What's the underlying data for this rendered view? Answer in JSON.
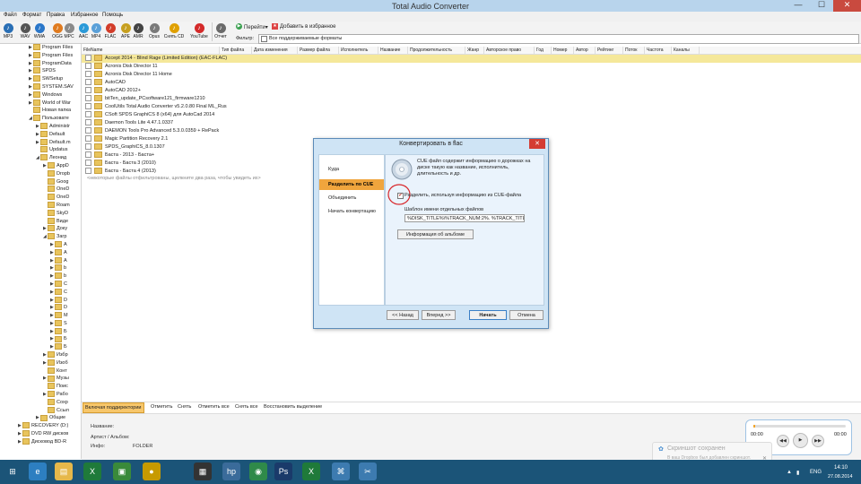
{
  "app_title": "Total Audio Converter",
  "window_buttons": {
    "minimize": "—",
    "maximize": "☐",
    "close": "✕"
  },
  "menu": [
    "Файл",
    "Формат",
    "Правка",
    "Избранное",
    "Помощь"
  ],
  "toolbar": {
    "formats": [
      {
        "label": "MP3",
        "color": "#2a6fb5"
      },
      {
        "label": "WAV",
        "color": "#555555"
      },
      {
        "label": "WMA",
        "color": "#2b77c9"
      },
      {
        "label": "OGG",
        "color": "#e07b1f"
      },
      {
        "label": "MPC",
        "color": "#8a8a8a"
      },
      {
        "label": "AAC",
        "color": "#2b9ad8"
      },
      {
        "label": "MP4",
        "color": "#5aa0d8"
      },
      {
        "label": "FLAC",
        "color": "#d23d2a"
      },
      {
        "label": "APE",
        "color": "#c7a020"
      },
      {
        "label": "AMR",
        "color": "#444444"
      },
      {
        "label": "Opus",
        "color": "#7a7a7a"
      },
      {
        "label": "Снять CD",
        "color": "#e0a000"
      },
      {
        "label": "YouTube",
        "color": "#d42a2a"
      },
      {
        "label": "Отчет",
        "color": "#6a6a6a"
      }
    ],
    "goto_label": "Перейти▾",
    "fav_label": "Добавить в избранное",
    "filter_label": "Фильтр:",
    "filter_value": "Все поддерживаемые форматы"
  },
  "tree": [
    {
      "label": "Program Files",
      "indent": 1,
      "exp": "▶"
    },
    {
      "label": "Program Files",
      "indent": 1,
      "exp": "▶"
    },
    {
      "label": "ProgramData",
      "indent": 1,
      "exp": "▶"
    },
    {
      "label": "SPDS",
      "indent": 1,
      "exp": "▶"
    },
    {
      "label": "SWSetup",
      "indent": 1,
      "exp": "▶"
    },
    {
      "label": "SYSTEM.SAV",
      "indent": 1,
      "exp": "▶"
    },
    {
      "label": "Windows",
      "indent": 1,
      "exp": "▶"
    },
    {
      "label": "World of War",
      "indent": 1,
      "exp": "▶"
    },
    {
      "label": "Новая папка",
      "indent": 1,
      "exp": ""
    },
    {
      "label": "Пользовате",
      "indent": 1,
      "exp": "◢"
    },
    {
      "label": "Administr",
      "indent": 2,
      "exp": "▶"
    },
    {
      "label": "Default",
      "indent": 2,
      "exp": "▶"
    },
    {
      "label": "Default.m",
      "indent": 2,
      "exp": "▶"
    },
    {
      "label": "Updatus",
      "indent": 2,
      "exp": ""
    },
    {
      "label": "Леонид",
      "indent": 2,
      "exp": "◢"
    },
    {
      "label": "AppD",
      "indent": 3,
      "exp": "▶"
    },
    {
      "label": "Dropb",
      "indent": 3,
      "exp": ""
    },
    {
      "label": "Goog",
      "indent": 3,
      "exp": ""
    },
    {
      "label": "OneD",
      "indent": 3,
      "exp": ""
    },
    {
      "label": "OneD",
      "indent": 3,
      "exp": ""
    },
    {
      "label": "Roam",
      "indent": 3,
      "exp": ""
    },
    {
      "label": "SkyD",
      "indent": 3,
      "exp": ""
    },
    {
      "label": "Виде",
      "indent": 3,
      "exp": ""
    },
    {
      "label": "Доку",
      "indent": 3,
      "exp": "▶"
    },
    {
      "label": "Загр",
      "indent": 3,
      "exp": "◢"
    },
    {
      "label": "A",
      "indent": 4,
      "exp": "▶"
    },
    {
      "label": "A",
      "indent": 4,
      "exp": "▶"
    },
    {
      "label": "A",
      "indent": 4,
      "exp": "▶"
    },
    {
      "label": "b",
      "indent": 4,
      "exp": "▶"
    },
    {
      "label": "b",
      "indent": 4,
      "exp": "▶"
    },
    {
      "label": "C",
      "indent": 4,
      "exp": "▶"
    },
    {
      "label": "C",
      "indent": 4,
      "exp": "▶"
    },
    {
      "label": "D",
      "indent": 4,
      "exp": "▶"
    },
    {
      "label": "D",
      "indent": 4,
      "exp": "▶"
    },
    {
      "label": "M",
      "indent": 4,
      "exp": "▶"
    },
    {
      "label": "S",
      "indent": 4,
      "exp": "▶"
    },
    {
      "label": "Б",
      "indent": 4,
      "exp": "▶"
    },
    {
      "label": "Б",
      "indent": 4,
      "exp": "▶"
    },
    {
      "label": "Б",
      "indent": 4,
      "exp": "▶"
    },
    {
      "label": "Избр",
      "indent": 3,
      "exp": "▶"
    },
    {
      "label": "Изоб",
      "indent": 3,
      "exp": "▶"
    },
    {
      "label": "Конт",
      "indent": 3,
      "exp": ""
    },
    {
      "label": "Музы",
      "indent": 3,
      "exp": "▶"
    },
    {
      "label": "Поис",
      "indent": 3,
      "exp": ""
    },
    {
      "label": "Рабо",
      "indent": 3,
      "exp": "▶"
    },
    {
      "label": "Сохр",
      "indent": 3,
      "exp": ""
    },
    {
      "label": "Ссыл",
      "indent": 3,
      "exp": ""
    },
    {
      "label": "Общие",
      "indent": 2,
      "exp": "▶"
    },
    {
      "label": "RECOVERY (D:)",
      "indent": 0,
      "exp": "▶"
    },
    {
      "label": "DVD RW дисков",
      "indent": 0,
      "exp": "▶"
    },
    {
      "label": "Дисковод BD-R",
      "indent": 0,
      "exp": "▶"
    }
  ],
  "columns": [
    "FileName",
    "Тип файла",
    "Дата изменения",
    "Размер файла",
    "Исполнитель",
    "Название",
    "Продолжительность",
    "Жанр",
    "Авторское право",
    "Год",
    "Номер",
    "Автор",
    "Рейтинг",
    "Поток",
    "Частота",
    "Каналы"
  ],
  "files": [
    {
      "name": "Accept 2014 - Blind Rage (Limited Edition) (EAC-FLAC)",
      "selected": true
    },
    {
      "name": "Acronis Disk Director 11",
      "selected": false
    },
    {
      "name": "Acronis Disk Director 11 Home",
      "selected": false
    },
    {
      "name": "AutoCAD",
      "selected": false
    },
    {
      "name": "AutoCAD 2012+",
      "selected": false
    },
    {
      "name": "bitTen_update_PCsoftware121_firmware1210",
      "selected": false
    },
    {
      "name": "CoolUtils Total Audio Converter v5.2.0.80 Final ML_Rus",
      "selected": false
    },
    {
      "name": "CSoft SPDS GraphiCS 8 (x64) для AutoCad 2014",
      "selected": false
    },
    {
      "name": "Daemon Tools Lite 4.47.1.0337",
      "selected": false
    },
    {
      "name": "DAEMON Tools Pro Advanced 5.3.0.0359 + RePack",
      "selected": false
    },
    {
      "name": "Magic Partition Recovery 2.1",
      "selected": false
    },
    {
      "name": "SPDS_GraphiCS_8.0.1307",
      "selected": false
    },
    {
      "name": "Баста - 2013 - Баста+",
      "selected": false
    },
    {
      "name": "Баста - Баста 3 (2010)",
      "selected": false
    },
    {
      "name": "Баста - Баста 4 (2013)",
      "selected": false
    }
  ],
  "filtered_note": "<некоторые файлы отфильтрованы, щелкните два раза, чтобы увидеть их>",
  "bottom_buttons": [
    "Включая поддиректории",
    "Отметить",
    "Снять",
    "Отметить все",
    "Снять все",
    "Восстановить выделение"
  ],
  "info": {
    "name_label": "Название:",
    "artist_label": "Артист / Альбом:",
    "info_label": "Инфо:",
    "info_value": "FOLDER"
  },
  "player": {
    "time_left": "00:00",
    "time_right": "00:00",
    "progress": 0.02
  },
  "toast": {
    "title": "Скриншот сохранен",
    "text": "В ваш Dropbox был добавлен скриншот."
  },
  "dialog": {
    "title": "Конвертировать в flac",
    "nav": [
      "Куда",
      "Разделить по CUE",
      "Объединить",
      "Начать конвертацию"
    ],
    "active_nav": 1,
    "cue_text": "CUE файл содержит информацию о дорожках на диске такую как название, исполнитель, длительность и др.",
    "split_label": "Разделить, используя информацию из CUE-файла",
    "split_checked": true,
    "template_label": "Шаблон имени отдельных файлов",
    "template_value": "%DISK_TITLE%\\%TRACK_NUM:2%. %TRACK_TITLE%",
    "album_info_btn": "Информация об альбоме",
    "back_btn": "<< Назад",
    "next_btn": "Вперед >>",
    "start_btn": "Начать",
    "cancel_btn": "Отмена"
  },
  "taskbar": {
    "icons": [
      {
        "name": "start-icon",
        "glyph": "⊞",
        "color": "#1b5478"
      },
      {
        "name": "ie-icon",
        "glyph": "e",
        "color": "#2d7fc1"
      },
      {
        "name": "explorer-icon",
        "glyph": "▤",
        "color": "#e6b84a"
      },
      {
        "name": "excel-icon",
        "glyph": "X",
        "color": "#1f7a3a"
      },
      {
        "name": "store-icon",
        "glyph": "▣",
        "color": "#3a8a3a"
      },
      {
        "name": "media-icon",
        "glyph": "●",
        "color": "#c79a00"
      },
      {
        "name": "app-icon",
        "glyph": "▦",
        "color": "#333333"
      },
      {
        "name": "hp-icon",
        "glyph": "hp",
        "color": "#3a6b9a"
      },
      {
        "name": "chrome-icon",
        "glyph": "◉",
        "color": "#2f8a4a"
      },
      {
        "name": "photoshop-icon",
        "glyph": "Ps",
        "color": "#1a3a6a"
      },
      {
        "name": "excel2-icon",
        "glyph": "X",
        "color": "#1f7a3a"
      },
      {
        "name": "network-icon",
        "glyph": "⌘",
        "color": "#3d7bb0"
      },
      {
        "name": "tools-icon",
        "glyph": "✂",
        "color": "#3d7bb0"
      }
    ],
    "lang": "ENG",
    "time": "14:10",
    "date": "27.08.2014"
  }
}
